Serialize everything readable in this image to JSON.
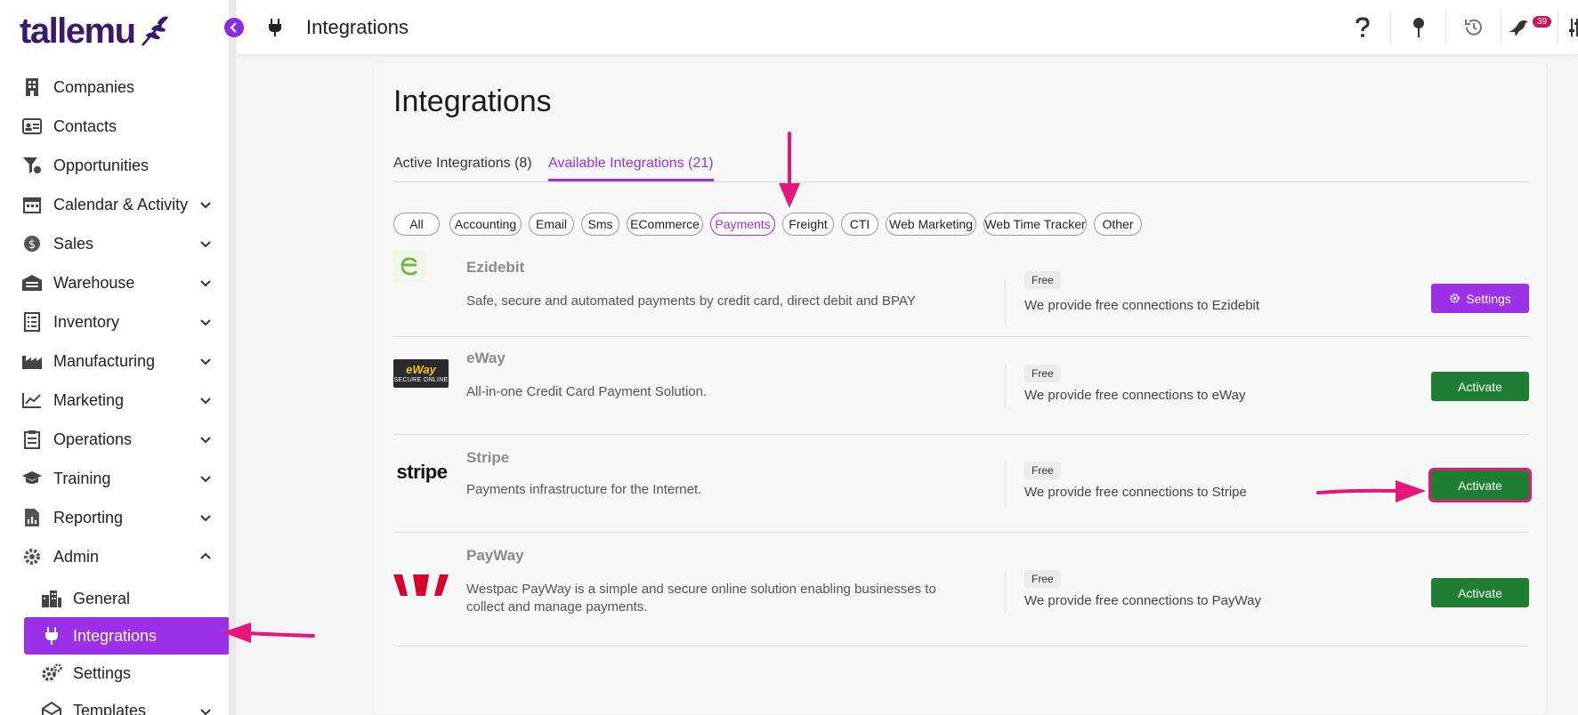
{
  "app": {
    "logo_text": "tallemu"
  },
  "topbar": {
    "title": "Integrations",
    "notification_count": "39"
  },
  "sidebar": {
    "items": [
      {
        "label": "Companies",
        "icon": "building-icon",
        "has_chevron": false
      },
      {
        "label": "Contacts",
        "icon": "id-card-icon",
        "has_chevron": false
      },
      {
        "label": "Opportunities",
        "icon": "funnel-icon",
        "has_chevron": false
      },
      {
        "label": "Calendar & Activity",
        "icon": "calendar-icon",
        "has_chevron": true
      },
      {
        "label": "Sales",
        "icon": "dollar-icon",
        "has_chevron": true
      },
      {
        "label": "Warehouse",
        "icon": "warehouse-icon",
        "has_chevron": true
      },
      {
        "label": "Inventory",
        "icon": "list-icon",
        "has_chevron": true
      },
      {
        "label": "Manufacturing",
        "icon": "factory-icon",
        "has_chevron": true
      },
      {
        "label": "Marketing",
        "icon": "chart-icon",
        "has_chevron": true
      },
      {
        "label": "Operations",
        "icon": "clipboard-icon",
        "has_chevron": true
      },
      {
        "label": "Training",
        "icon": "graduation-cap-icon",
        "has_chevron": true
      },
      {
        "label": "Reporting",
        "icon": "report-icon",
        "has_chevron": true
      },
      {
        "label": "Admin",
        "icon": "gear-icon",
        "has_chevron": true,
        "expanded": true
      }
    ],
    "admin_subitems": [
      {
        "label": "General",
        "icon": "city-icon"
      },
      {
        "label": "Integrations",
        "icon": "plug-icon",
        "active": true
      },
      {
        "label": "Settings",
        "icon": "gears-icon"
      },
      {
        "label": "Templates",
        "icon": "envelope-icon"
      }
    ]
  },
  "main": {
    "title": "Integrations",
    "tabs": [
      {
        "label": "Active Integrations (8)",
        "active": false
      },
      {
        "label": "Available Integrations (21)",
        "active": true
      }
    ],
    "filters": [
      "All",
      "Accounting",
      "Email",
      "Sms",
      "ECommerce",
      "Payments",
      "Freight",
      "CTI",
      "Web Marketing",
      "Web Time Tracker",
      "Other"
    ],
    "active_filter": "Payments",
    "integrations": [
      {
        "name": "Ezidebit",
        "description": "Safe, secure and automated payments by credit card, direct debit and BPAY",
        "price_badge": "Free",
        "price_text": "We provide free connections to Ezidebit",
        "button": "Settings"
      },
      {
        "name": "eWay",
        "description": "All-in-one Credit Card Payment Solution.",
        "price_badge": "Free",
        "price_text": "We provide free connections to eWay",
        "button": "Activate",
        "logo_text": "eWay",
        "logo_subtext": "SECURE ONLINE"
      },
      {
        "name": "Stripe",
        "description": "Payments infrastructure for the Internet.",
        "price_badge": "Free",
        "price_text": "We provide free connections to Stripe",
        "button": "Activate",
        "logo_text": "stripe"
      },
      {
        "name": "PayWay",
        "description": "Westpac PayWay is a simple and secure online solution enabling businesses to collect and manage payments.",
        "price_badge": "Free",
        "price_text": "We provide free connections to PayWay",
        "button": "Activate"
      }
    ]
  },
  "colors": {
    "brand_purple": "#9b30e8",
    "logo_dark": "#3b1a6e",
    "activate_green": "#1e7e34",
    "annotation_pink": "#e5177b"
  }
}
